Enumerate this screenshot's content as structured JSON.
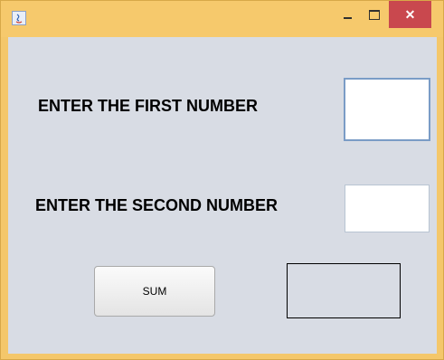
{
  "window": {
    "controls": {
      "minimize_icon": "minimize-icon",
      "maximize_icon": "maximize-icon",
      "close_glyph": "✕"
    }
  },
  "form": {
    "first_label": "ENTER THE FIRST NUMBER",
    "first_value": "",
    "second_label": "ENTER THE SECOND NUMBER",
    "second_value": "",
    "sum_button_label": "SUM",
    "result_value": ""
  },
  "colors": {
    "titlebar": "#f6c96c",
    "close_button": "#c9484e",
    "content_background": "#d8dce4",
    "focused_field_border": "#7a9cc6"
  }
}
